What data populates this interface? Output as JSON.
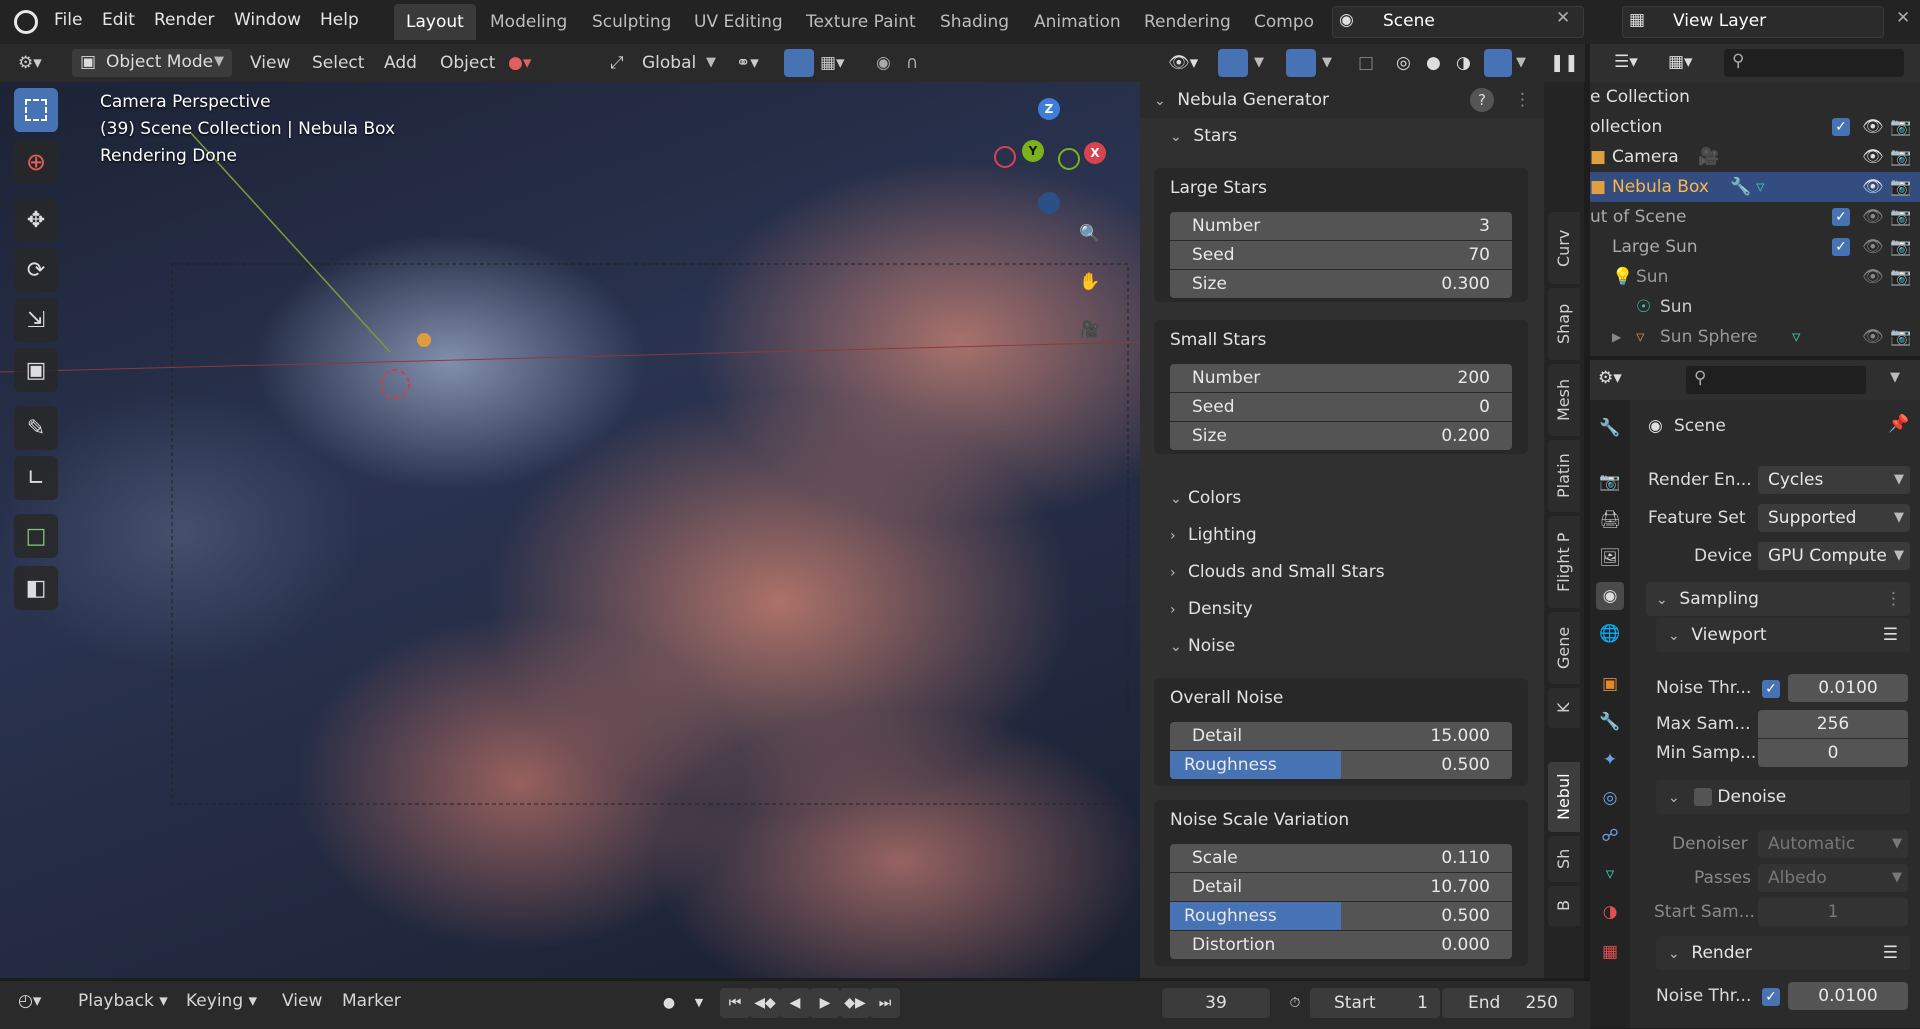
{
  "topbar": {
    "menus": [
      "File",
      "Edit",
      "Render",
      "Window",
      "Help"
    ],
    "workspaces": [
      "Layout",
      "Modeling",
      "Sculpting",
      "UV Editing",
      "Texture Paint",
      "Shading",
      "Animation",
      "Rendering",
      "Compo"
    ],
    "active_workspace": "Layout",
    "scene_name": "Scene",
    "view_layer": "View Layer"
  },
  "header": {
    "mode": "Object Mode",
    "menus": [
      "View",
      "Select",
      "Add",
      "Object"
    ],
    "orientation": "Global"
  },
  "viewport": {
    "overlay_lines": [
      "Camera Perspective",
      "(39) Scene Collection | Nebula Box",
      "Rendering Done"
    ],
    "gizmo_axes": [
      "Z",
      "Y",
      "X"
    ]
  },
  "npanel": {
    "title": "Nebula Generator",
    "stars_header": "Stars",
    "large_stars": {
      "title": "Large Stars",
      "fields": [
        {
          "label": "Number",
          "value": "3"
        },
        {
          "label": "Seed",
          "value": "70"
        },
        {
          "label": "Size",
          "value": "0.300"
        }
      ]
    },
    "small_stars": {
      "title": "Small Stars",
      "fields": [
        {
          "label": "Number",
          "value": "200"
        },
        {
          "label": "Seed",
          "value": "0"
        },
        {
          "label": "Size",
          "value": "0.200"
        }
      ]
    },
    "sections": [
      "Colors",
      "Lighting",
      "Clouds and Small Stars",
      "Density",
      "Noise"
    ],
    "overall_noise": {
      "title": "Overall Noise",
      "fields": [
        {
          "label": "Detail",
          "value": "15.000"
        },
        {
          "label": "Roughness",
          "value": "0.500",
          "fill": 0.5
        }
      ]
    },
    "noise_scale_variation": {
      "title": "Noise Scale Variation",
      "fields": [
        {
          "label": "Scale",
          "value": "0.110"
        },
        {
          "label": "Detail",
          "value": "10.700"
        },
        {
          "label": "Roughness",
          "value": "0.500",
          "fill": 0.5
        },
        {
          "label": "Distortion",
          "value": "0.000"
        }
      ]
    }
  },
  "side_tabs": [
    "Curv",
    "Shap",
    "Mesh",
    "Platin",
    "Flight P",
    "Gene",
    "K",
    "Nebul",
    "Sh",
    "B"
  ],
  "active_side_tab": "Nebul",
  "outliner": {
    "rows": [
      {
        "label": "e Collection"
      },
      {
        "label": "ollection"
      },
      {
        "label": "Camera"
      },
      {
        "label": "Nebula Box"
      },
      {
        "label": "ut of Scene"
      },
      {
        "label": "Large Sun"
      },
      {
        "label": "Sun"
      },
      {
        "label": "Sun"
      },
      {
        "label": "Sun Sphere"
      }
    ]
  },
  "properties": {
    "context": "Scene",
    "render_engine_label": "Render En...",
    "render_engine": "Cycles",
    "feature_set_label": "Feature Set",
    "feature_set": "Supported",
    "device_label": "Device",
    "device": "GPU Compute",
    "sampling": "Sampling",
    "viewport": "Viewport",
    "noise_threshold_label": "Noise Thr...",
    "noise_threshold": "0.0100",
    "max_samples_label": "Max Sam...",
    "max_samples": "256",
    "min_samples_label": "Min Samp...",
    "min_samples": "0",
    "denoise": "Denoise",
    "denoiser_label": "Denoiser",
    "denoiser": "Automatic",
    "passes_label": "Passes",
    "passes": "Albedo",
    "start_samples_label": "Start Sam...",
    "start_samples": "1",
    "render": "Render",
    "render_noise_threshold_label": "Noise Thr...",
    "render_noise_threshold": "0.0100"
  },
  "timeline": {
    "playback": "Playback",
    "keying": "Keying",
    "view": "View",
    "marker": "Marker",
    "current_frame": "39",
    "start_label": "Start",
    "start": "1",
    "end_label": "End",
    "end": "250"
  },
  "colors": {
    "accent": "#4772b3",
    "selected_text": "#ffb54a"
  }
}
